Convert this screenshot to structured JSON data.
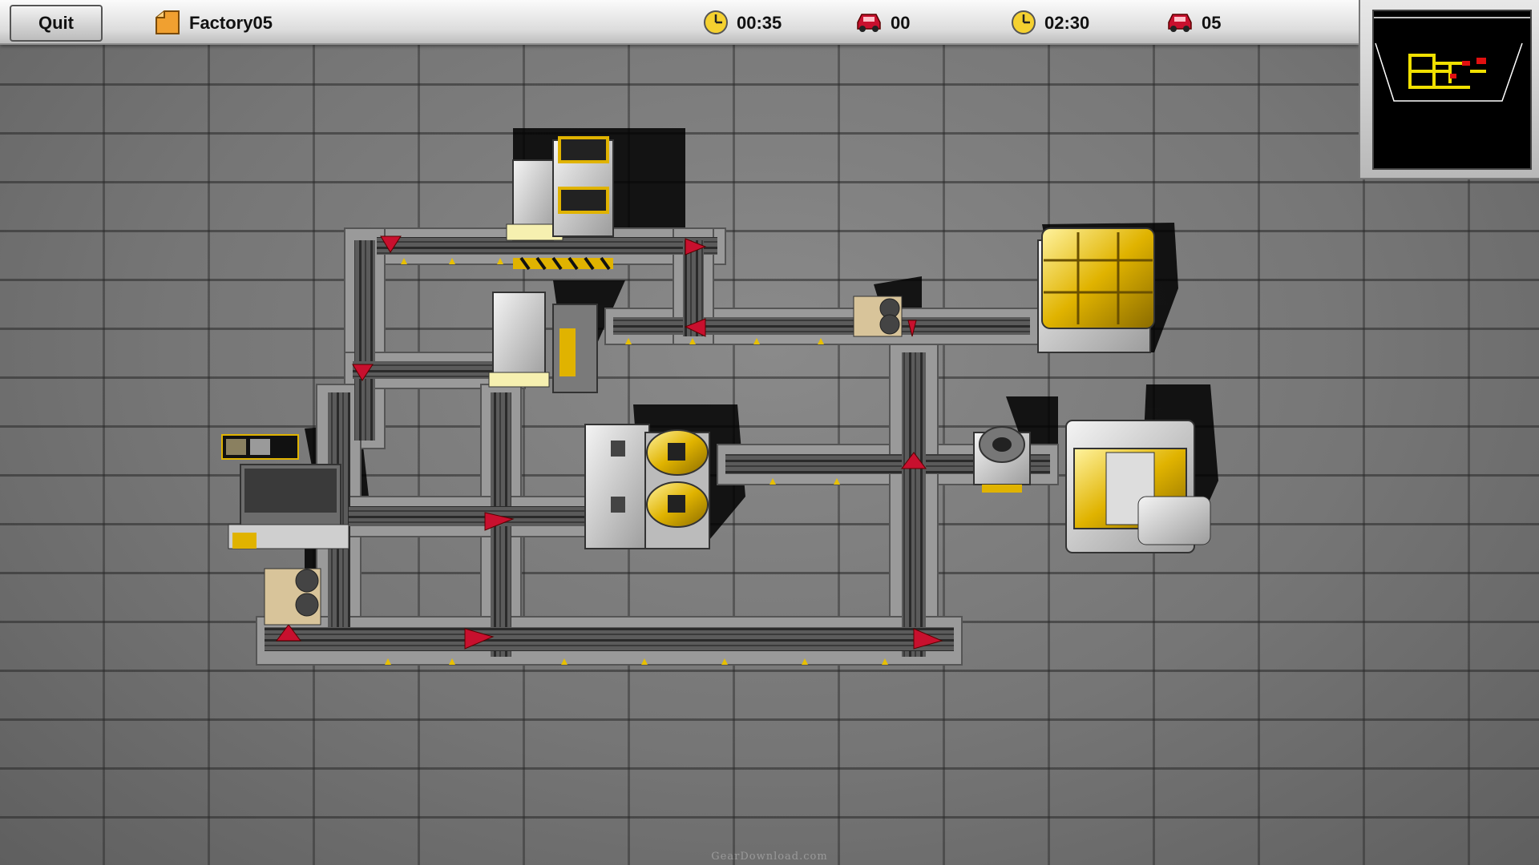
{
  "hud": {
    "quit_label": "Quit",
    "level_name": "Factory05",
    "elapsed_time": "00:35",
    "cars_built": "00",
    "time_limit": "02:30",
    "cars_target": "05"
  },
  "icons": {
    "level": "folder-icon",
    "clock": "clock-icon",
    "car": "car-icon"
  },
  "colors": {
    "hud_bar": "#dcdcdc",
    "accent_yellow": "#e8c000",
    "car_red": "#c8102e",
    "minimap_bg": "#000000"
  },
  "watermark": "GearDownload.com"
}
